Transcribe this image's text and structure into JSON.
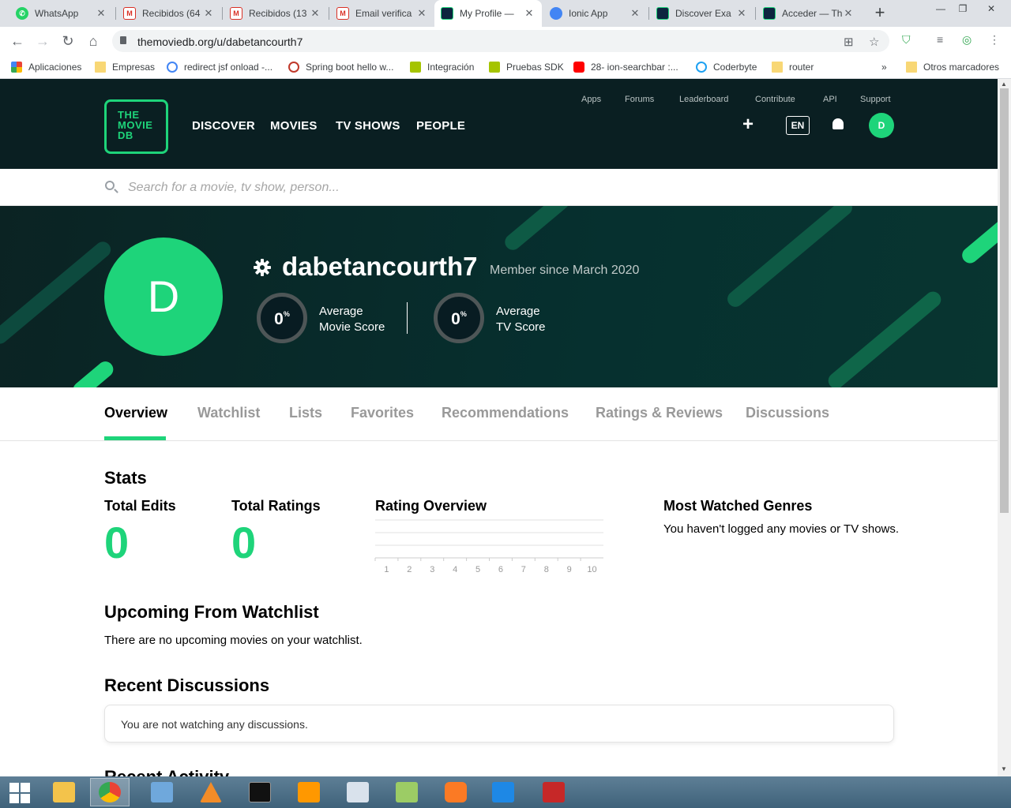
{
  "browser": {
    "tabs": [
      {
        "title": "WhatsApp",
        "icon": "whatsapp-icon",
        "color": "#25d366"
      },
      {
        "title": "Recibidos (64",
        "icon": "gmail-icon",
        "color": "#d93025"
      },
      {
        "title": "Recibidos (13",
        "icon": "gmail-icon",
        "color": "#d93025"
      },
      {
        "title": "Email verifica",
        "icon": "gmail-icon",
        "color": "#d93025"
      },
      {
        "title": "My Profile —",
        "icon": "tmdb-icon",
        "color": "#0d253f"
      },
      {
        "title": "Ionic App",
        "icon": "globe-icon",
        "color": "#4285f4"
      },
      {
        "title": "Discover Exa",
        "icon": "tmdb-icon",
        "color": "#0d253f"
      },
      {
        "title": "Acceder — Th",
        "icon": "tmdb-icon",
        "color": "#0d253f"
      }
    ],
    "url": "themoviedb.org/u/dabetancourth7",
    "bookmarks": [
      {
        "label": "Aplicaciones",
        "icon": "apps-grid-icon"
      },
      {
        "label": "Empresas",
        "icon": "folder-icon"
      },
      {
        "label": "redirect jsf onload -...",
        "icon": "google-icon"
      },
      {
        "label": "Spring boot hello w...",
        "icon": "bookmark-site-icon"
      },
      {
        "label": "Integración",
        "icon": "udemy-icon"
      },
      {
        "label": "Pruebas SDK",
        "icon": "udemy-icon"
      },
      {
        "label": "28- ion-searchbar :...",
        "icon": "youtube-icon"
      },
      {
        "label": "Coderbyte",
        "icon": "coderbyte-icon"
      },
      {
        "label": "router",
        "icon": "folder-icon"
      }
    ],
    "bookmarks_more": "»",
    "other_bookmarks": "Otros marcadores"
  },
  "site": {
    "logo_lines": [
      "THE",
      "MOVIE",
      "DB"
    ],
    "main_nav": [
      "DISCOVER",
      "MOVIES",
      "TV SHOWS",
      "PEOPLE"
    ],
    "sub_nav": [
      "Apps",
      "Forums",
      "Leaderboard",
      "Contribute",
      "API",
      "Support"
    ],
    "lang": "EN",
    "avatar_initial": "D",
    "search_placeholder": "Search for a movie, tv show, person...",
    "accent": "#1ed47a"
  },
  "profile": {
    "initial": "D",
    "username": "dabetancourth7",
    "member_since": "Member since March 2020",
    "movie_score": "0",
    "movie_score_label_1": "Average",
    "movie_score_label_2": "Movie Score",
    "tv_score": "0",
    "tv_score_label_1": "Average",
    "tv_score_label_2": "TV Score",
    "pct": "%"
  },
  "tabs": [
    "Overview",
    "Watchlist",
    "Lists",
    "Favorites",
    "Recommendations",
    "Ratings & Reviews",
    "Discussions"
  ],
  "active_tab": "Overview",
  "stats": {
    "heading": "Stats",
    "total_edits_label": "Total Edits",
    "total_edits": "0",
    "total_ratings_label": "Total Ratings",
    "total_ratings": "0",
    "rating_overview_title": "Rating Overview",
    "genres_title": "Most Watched Genres",
    "genres_empty": "You haven't logged any movies or TV shows."
  },
  "chart_data": {
    "type": "bar",
    "title": "Rating Overview",
    "categories": [
      "1",
      "2",
      "3",
      "4",
      "5",
      "6",
      "7",
      "8",
      "9",
      "10"
    ],
    "values": [
      0,
      0,
      0,
      0,
      0,
      0,
      0,
      0,
      0,
      0
    ]
  },
  "upcoming": {
    "heading": "Upcoming From Watchlist",
    "empty": "There are no upcoming movies on your watchlist."
  },
  "discussions": {
    "heading": "Recent Discussions",
    "empty": "You are not watching any discussions."
  },
  "activity": {
    "heading": "Recent Activity"
  }
}
